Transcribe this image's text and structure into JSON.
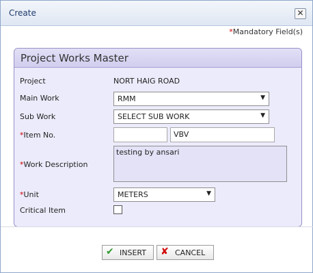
{
  "window": {
    "title": "Create",
    "close_glyph": "✕"
  },
  "mandatory": {
    "star": "*",
    "label": "Mandatory Field(s)"
  },
  "panel": {
    "title": "Project Works Master",
    "fields": {
      "project": {
        "label": "Project",
        "value": "NORT HAIG ROAD"
      },
      "main_work": {
        "label": "Main Work",
        "value": "RMM"
      },
      "sub_work": {
        "label": "Sub Work",
        "value": "SELECT SUB WORK"
      },
      "item_no": {
        "star": "*",
        "label": "Item No.",
        "value1": "",
        "value2": "VBV"
      },
      "work_description": {
        "star": "*",
        "label": "Work Description",
        "value": "testing by ansari"
      },
      "unit": {
        "star": "*",
        "label": "Unit",
        "value": "METERS"
      },
      "critical_item": {
        "label": "Critical Item",
        "checked": false
      }
    }
  },
  "buttons": {
    "insert": {
      "label": "INSERT",
      "icon": "check-icon",
      "glyph": "✔",
      "color": "#2e9a2e"
    },
    "cancel": {
      "label": "CANCEL",
      "icon": "x-icon",
      "glyph": "✘",
      "color": "#d10000"
    }
  },
  "colors": {
    "panel_bg": "#ecebfb",
    "panel_border": "#9890c8",
    "title_text": "#1d3a6a",
    "required": "#d10000"
  }
}
